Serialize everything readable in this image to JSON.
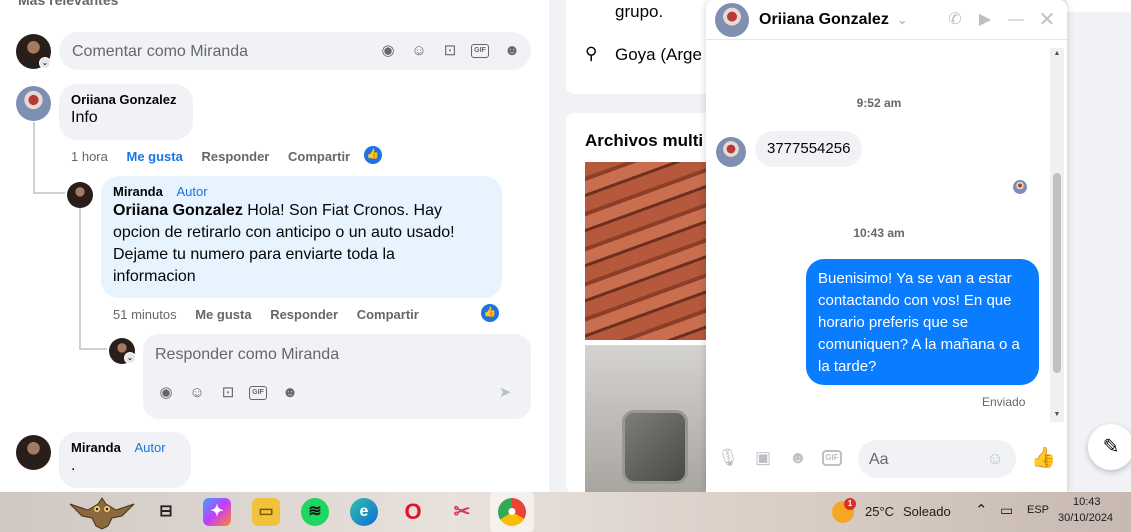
{
  "left_panel": {
    "top_cut_label": "Más relevantes",
    "comment_placeholder": "Comentar como Miranda",
    "comments": [
      {
        "author": "Oriiana Gonzalez",
        "text": "Info",
        "time": "1 hora",
        "like": "Me gusta",
        "reply": "Responder",
        "share": "Compartir"
      },
      {
        "author": "Miranda",
        "badge": "Autor",
        "mention": "Oriiana Gonzalez",
        "text_lines": [
          " Hola! Son Fiat Cronos. Hay",
          "opcion de retirarlo con anticipo o un auto usado!",
          "Dejame tu numero para enviarte toda la",
          "informacion"
        ],
        "time": "51 minutos",
        "like": "Me gusta",
        "reply": "Responder",
        "share": "Compartir"
      },
      {
        "author": "Miranda",
        "badge": "Autor",
        "text": "."
      }
    ],
    "reply_placeholder": "Responder como Miranda"
  },
  "middle_panel": {
    "top_text": "grupo.",
    "location": "Goya (Arge",
    "media_title": "Archivos multi"
  },
  "chat": {
    "contact_name": "Oriiana Gonzalez",
    "timestamp_1": "9:52 am",
    "incoming_message": "3777554256",
    "timestamp_2": "10:43 am",
    "outgoing_message": "Buenisimo! Ya se van a estar contactando con vos! En que horario preferis que se comuniquen? A la mañana o a la tarde?",
    "status": "Enviado",
    "composer_placeholder": "Aa",
    "gif_label": "GIF"
  },
  "taskbar": {
    "weather_temp": "25°C",
    "weather_desc": "Soleado",
    "weather_badge": "1",
    "language": "ESP",
    "time": "10:43",
    "date": "30/10/2024"
  },
  "colors": {
    "messenger_blue": "#0a7cff",
    "facebook_blue": "#1b74e4",
    "bubble_gray": "#f0f2f5"
  }
}
